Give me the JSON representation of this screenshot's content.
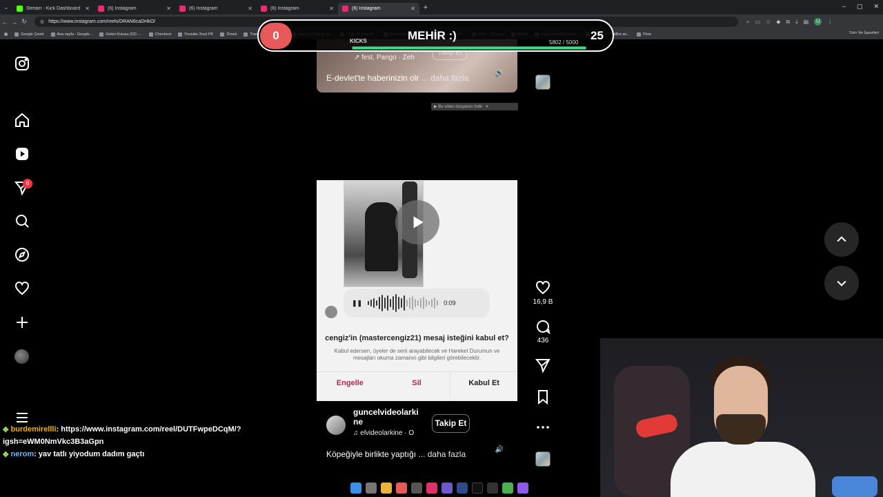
{
  "browser": {
    "tabs": [
      {
        "label": "Stream - Kick Dashboard",
        "color": "#53fc18",
        "active": false
      },
      {
        "label": "(6) Instagram",
        "color": "#e1306c",
        "active": false
      },
      {
        "label": "(6) Instagram",
        "color": "#e1306c",
        "active": false
      },
      {
        "label": "(6) Instagram",
        "color": "#e1306c",
        "active": false
      },
      {
        "label": "(6) Instagram",
        "color": "#e1306c",
        "active": true
      }
    ],
    "url": "https://www.instagram.com/reels/DRAN6caDHkO/",
    "bookmarks": [
      "Google Çeviri",
      "Ana sayfa - Google...",
      "Gelen Kutusu (52) -...",
      "Checkout",
      "Youtube 3ncü PK",
      "Örnek",
      "Transcript of \"Mi M...",
      "CapCut | Text to sp...",
      "Tube Thumbnail...",
      "Resize and reduce i...",
      "İspanyolca Ö...",
      "yGen - Projects",
      "BURÇ",
      "Esperanza000 Strea...",
      "The best ChatBot an...",
      "Flow"
    ],
    "bookmarks_all": "Tüm Yer İşaretleri",
    "profile_initial": "U"
  },
  "nav": {
    "notification_count": "6"
  },
  "reel_top": {
    "credits": "↗ fest, Pango · Zeh",
    "caption": "E-devlet'te haberinizin olr",
    "more": "... daha fazla",
    "follow_ghost": "Takip Et"
  },
  "download_chip": "▶ Bu video dosyasını İndir",
  "reel_main": {
    "audio_time": "0:09",
    "message_title": "cengiz'in (mastercengiz21) mesaj isteğini kabul et?",
    "message_sub": "Kabul edersen, üyeler de seni arayabilecek ve Hareket Durumun ve mesajları okuma zamanın gibi bilgileri görebilecektir.",
    "btn_block": "Engelle",
    "btn_delete": "Sil",
    "btn_accept": "Kabul Et",
    "username": "guncelvideolarkine",
    "audio": "♫ elvideolarkine · O",
    "follow": "Takip Et",
    "caption": "Köpeğiyle birlikte yaptığı",
    "more": "... daha fazla"
  },
  "actions": {
    "likes": "16,9 B",
    "comments": "436"
  },
  "overlay": {
    "left_value": "0",
    "title": "MEHİR :)",
    "right_value": "25",
    "kicks_label": "KICKS",
    "counter": "5802  / 5000",
    "progress_fraction": 1.0
  },
  "chat": [
    {
      "user": "burdemirellli",
      "text": ": https://www.instagram.com/reel/DUTFwpeDCqM/?igsh=eWM0NmVkc3B3aGpn"
    },
    {
      "user": "nerom",
      "text": ": yav tatlı yiyodum dadım gaçtı"
    }
  ],
  "colors": {
    "accent_red": "#ff3040",
    "overlay_red": "#e85a5a",
    "kick_green": "#53fc18"
  }
}
